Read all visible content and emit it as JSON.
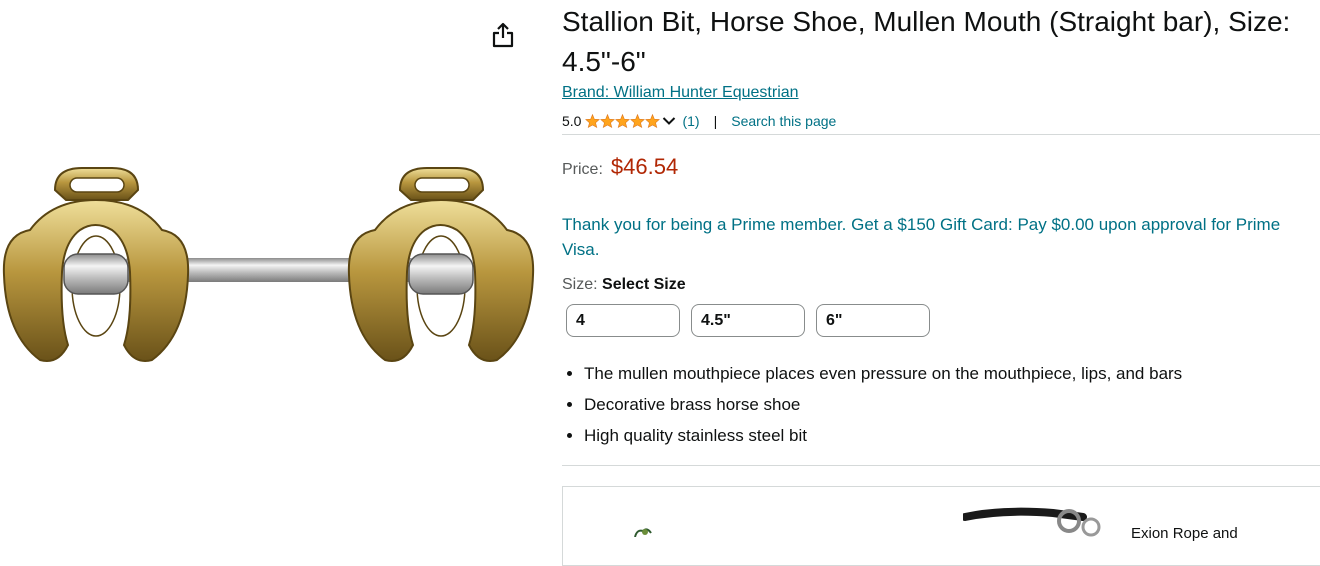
{
  "product": {
    "title": "Stallion Bit, Horse Shoe, Mullen Mouth (Straight bar), Size: 4.5\"-6\"",
    "brand": "Brand: William Hunter Equestrian",
    "rating_value": "5.0",
    "rating_count": "(1)",
    "search_link": "Search this page",
    "separator": "|",
    "price_label": "Price:",
    "price": "$46.54",
    "prime_message": "Thank you for being a Prime member. Get a $150 Gift Card: Pay $0.00 upon approval for Prime Visa.",
    "size_label": "Size:",
    "size_selected": "Select Size",
    "size_options": [
      "4",
      "4.5\"",
      "6\""
    ],
    "bullets": [
      "The mullen mouthpiece places even pressure on the mouthpiece, lips, and bars",
      "Decorative brass horse shoe",
      "High quality stainless steel bit"
    ]
  },
  "promo": {
    "text": "Exion Rope and"
  },
  "icons": {
    "share": "share-icon",
    "star": "star-icon",
    "chevron": "chevron-down-icon"
  },
  "colors": {
    "link": "#007185",
    "price": "#B12704",
    "star": "#FFA41C",
    "text": "#0F1111"
  },
  "rating": {
    "stars": 5,
    "max": 5
  }
}
